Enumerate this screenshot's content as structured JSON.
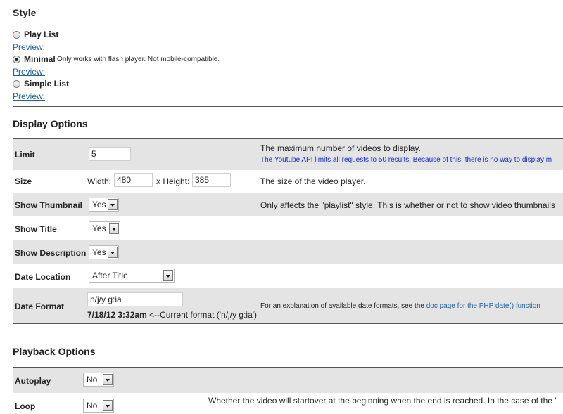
{
  "style_section": {
    "heading": "Style",
    "options": [
      {
        "label": "Play List",
        "note": "",
        "preview": "Preview:",
        "checked": false
      },
      {
        "label": "Minimal",
        "note": "Only works with flash player. Not mobile-compatible.",
        "preview": "Preview:",
        "checked": true
      },
      {
        "label": "Simple List",
        "note": "",
        "preview": "Preview:",
        "checked": false
      }
    ]
  },
  "display_options": {
    "heading": "Display Options",
    "limit": {
      "label": "Limit",
      "value": "5",
      "desc": "The maximum number of videos to display.",
      "note": "The Youtube API limits all requests to 50 results. Because of this, there is no way to display m"
    },
    "size": {
      "label": "Size",
      "width_label": "Width:",
      "width_value": "480",
      "height_label": "x Height:",
      "height_value": "385",
      "desc": "The size of the video player."
    },
    "show_thumbnail": {
      "label": "Show Thumbnail",
      "value": "Yes",
      "desc": "Only affects the \"playlist\" style. This is whether or not to show video thumbnails"
    },
    "show_title": {
      "label": "Show Title",
      "value": "Yes"
    },
    "show_description": {
      "label": "Show Description",
      "value": "Yes"
    },
    "date_location": {
      "label": "Date Location",
      "value": "After Title"
    },
    "date_format": {
      "label": "Date Format",
      "value": "n/j/y g:ia",
      "current_date": "7/18/12 3:32am",
      "current_suffix": "<--Current format ('n/j/y g:ia')",
      "desc_prefix": "For an explanation of available date formats, see the",
      "desc_link": "doc page for the PHP date() function"
    }
  },
  "playback_options": {
    "heading": "Playback Options",
    "autoplay": {
      "label": "Autoplay",
      "value": "No"
    },
    "loop": {
      "label": "Loop",
      "value": "No",
      "desc": "Whether the video will startover at the beginning when the end is reached. In the case of the '"
    }
  }
}
